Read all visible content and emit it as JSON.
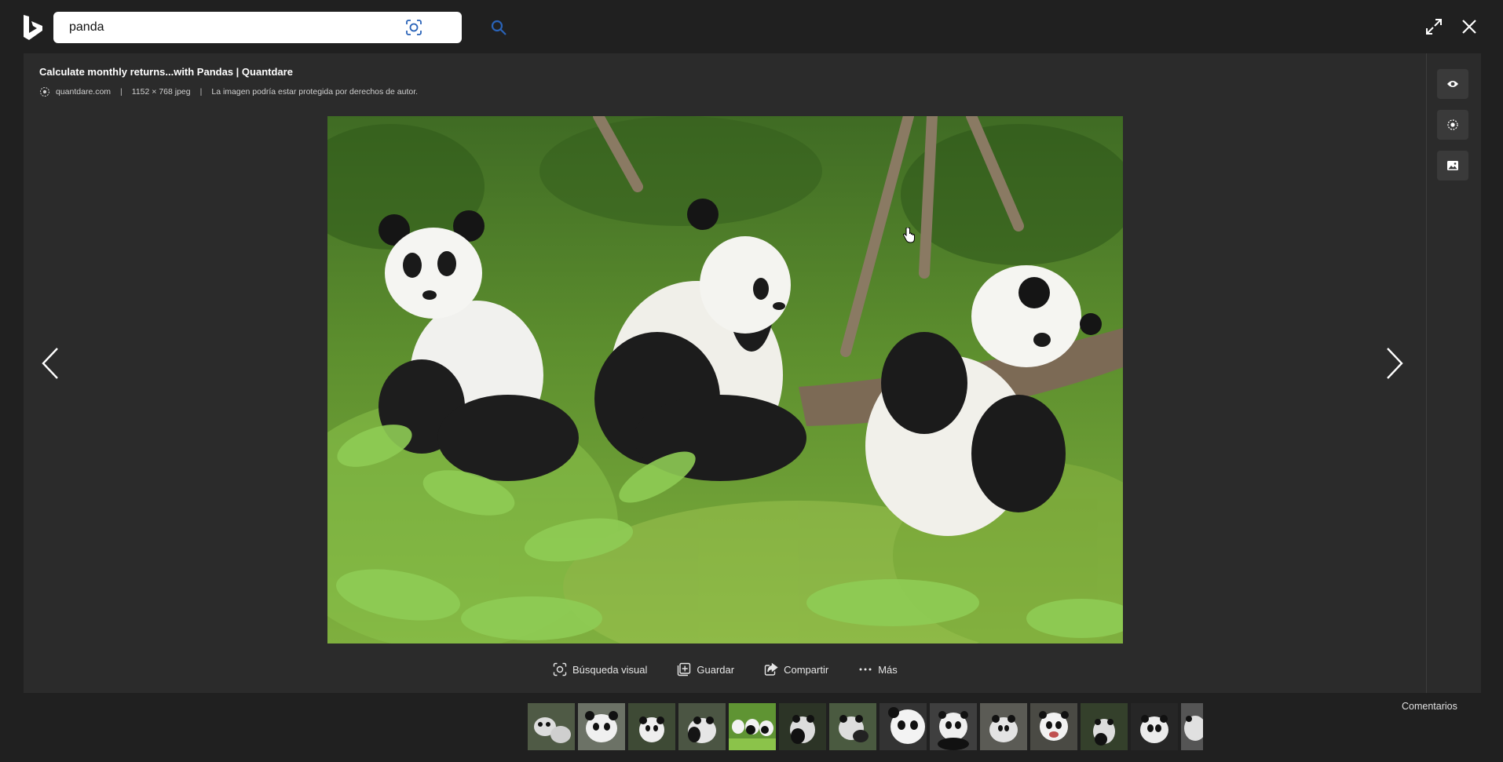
{
  "search": {
    "query": "panda"
  },
  "viewer": {
    "title": "Calculate monthly returns...with Pandas | Quantdare",
    "source": "quantdare.com",
    "dimensions": "1152 × 768 jpeg",
    "copyright": "La imagen podría estar protegida por derechos de autor."
  },
  "actions": [
    {
      "label": "Búsqueda visual",
      "icon": "visual-search-icon"
    },
    {
      "label": "Guardar",
      "icon": "save-icon"
    },
    {
      "label": "Compartir",
      "icon": "share-icon"
    },
    {
      "label": "Más",
      "icon": "more-icon"
    }
  ],
  "side_buttons": [
    "eye-icon",
    "globe-icon",
    "image-icon"
  ],
  "feedback": "Comentarios",
  "thumbnails": {
    "count": 14,
    "active_index": 4
  },
  "colors": {
    "background": "#202020",
    "panel": "#2b2b2b",
    "side_button": "#3a3a3a"
  }
}
